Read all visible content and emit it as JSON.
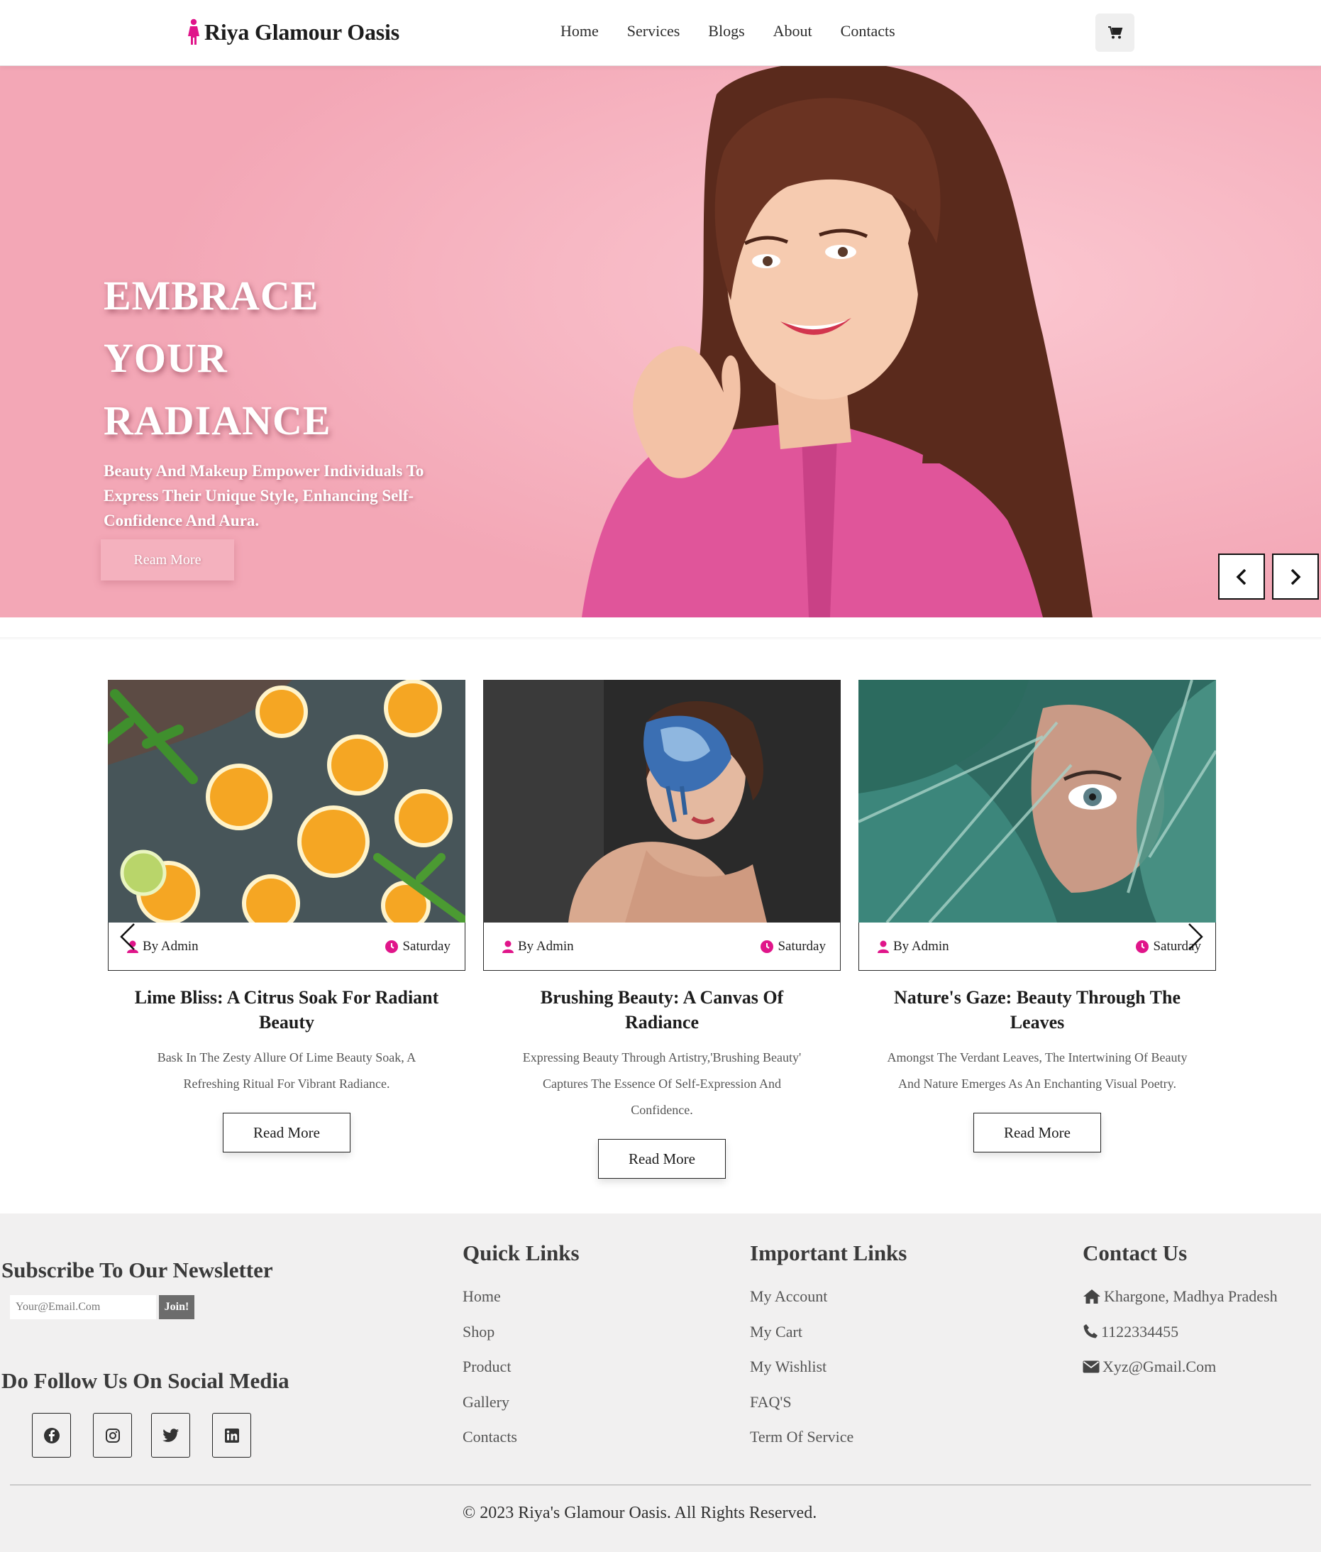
{
  "nav": {
    "brand": "Riya Glamour Oasis",
    "menu": [
      "Home",
      "Services",
      "Blogs",
      "About",
      "Contacts"
    ],
    "icons": {
      "logo": "woman-figure-icon",
      "cart": "cart-icon"
    }
  },
  "hero": {
    "title_lines": [
      "EMBRACE",
      "YOUR",
      "RADIANCE"
    ],
    "subtitle": "Beauty And Makeup Empower Individuals To Express Their Unique Style, Enhancing Self-Confidence And Aura.",
    "button": "Ream More",
    "prev_icon": "chevron-left-icon",
    "next_icon": "chevron-right-icon"
  },
  "blogs": {
    "cards": [
      {
        "author": "By Admin",
        "day": "Saturday",
        "title": "Lime Bliss: A Citrus Soak For Radiant Beauty",
        "excerpt": "Bask In The Zesty Allure Of Lime Beauty Soak, A Refreshing Ritual For Vibrant Radiance.",
        "button": "Read More"
      },
      {
        "author": "By Admin",
        "day": "Saturday",
        "title": "Brushing Beauty: A Canvas Of Radiance",
        "excerpt": "Expressing Beauty Through Artistry,'Brushing Beauty' Captures The Essence Of Self-Expression And Confidence.",
        "button": "Read More"
      },
      {
        "author": "By Admin",
        "day": "Saturday",
        "title": "Nature's Gaze: Beauty Through The Leaves",
        "excerpt": "Amongst The Verdant Leaves, The Intertwining Of Beauty And Nature Emerges As An Enchanting Visual Poetry.",
        "button": "Read More"
      }
    ],
    "icons": {
      "author": "user-icon",
      "day": "clock-icon",
      "prev": "chevron-left-icon",
      "next": "chevron-right-icon"
    }
  },
  "footer": {
    "newsletter": {
      "heading": "Subscribe To Our Newsletter",
      "placeholder": "Your@Email.Com",
      "button": "Join!"
    },
    "social": {
      "heading": "Do Follow Us On Social Media",
      "icons": [
        "facebook-icon",
        "instagram-icon",
        "twitter-icon",
        "linkedin-icon"
      ]
    },
    "quick_links": {
      "heading": "Quick Links",
      "items": [
        "Home",
        "Shop",
        "Product",
        "Gallery",
        "Contacts"
      ]
    },
    "important_links": {
      "heading": "Important Links",
      "items": [
        "My Account",
        "My Cart",
        "My Wishlist",
        "FAQ'S",
        "Term Of Service"
      ]
    },
    "contact": {
      "heading": "Contact Us",
      "address": "Khargone, Madhya Pradesh",
      "phone": "1122334455",
      "email": "Xyz@Gmail.Com",
      "icons": [
        "home-icon",
        "phone-icon",
        "envelope-icon"
      ]
    },
    "copyright": "© 2023 Riya's Glamour Oasis. All Rights Reserved."
  },
  "colors": {
    "accent": "#e0158a",
    "hero_pink": "#f6b3bf",
    "footer_bg": "#f1f0f0"
  }
}
